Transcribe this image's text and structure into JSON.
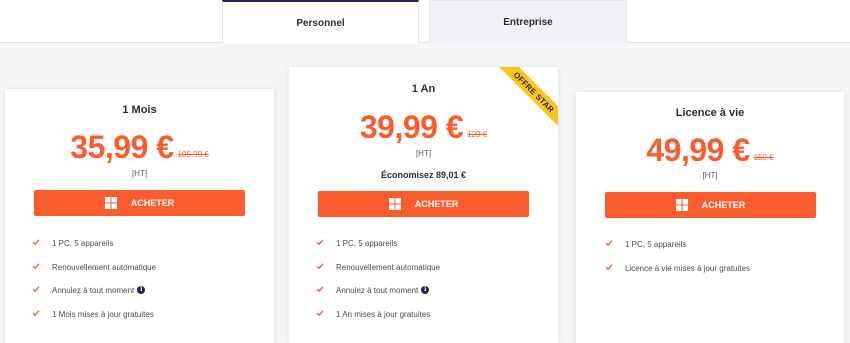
{
  "tabs": [
    {
      "label": "Personnel",
      "active": true
    },
    {
      "label": "Entreprise",
      "active": false
    }
  ],
  "colors": {
    "accent": "#fb5c2e",
    "ribbon": "#f9c61b",
    "navy": "#1f2454"
  },
  "plans": [
    {
      "title": "1 Mois",
      "price": "35,99 €",
      "old_price": "105,99 €",
      "ht": "[HT]",
      "buy_label": "ACHETER",
      "features": [
        "1 PC, 5 appareils",
        "Renouvellement automatique",
        "Annulez à tout moment",
        "1 Mois mises à jour gratuites"
      ]
    },
    {
      "title": "1 An",
      "ribbon": "OFFRE STAR",
      "price": "39,99 €",
      "old_price": "129 €",
      "ht": "[HT]",
      "savings": "Économisez 89,01 €",
      "buy_label": "ACHETER",
      "features": [
        "1 PC, 5 appareils",
        "Renouvellement automatique",
        "Annulez à tout moment",
        "1 An mises à jour gratuites"
      ]
    },
    {
      "title": "Licence à vie",
      "price": "49,99 €",
      "old_price": "159 €",
      "ht": "[HT]",
      "buy_label": "ACHETER",
      "features": [
        "1 PC, 5 appareils",
        "Licence à vie mises à jour gratuites"
      ]
    }
  ]
}
